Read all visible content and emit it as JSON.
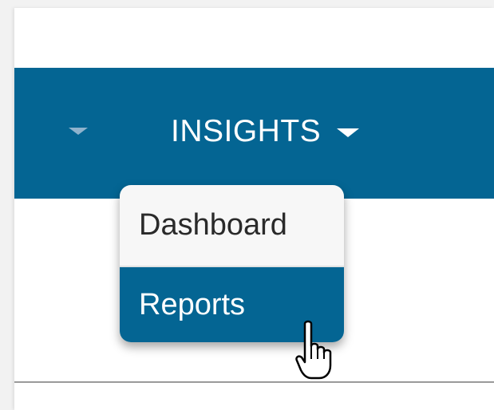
{
  "navbar": {
    "menu_label": "INSIGHTS",
    "colors": {
      "bar": "#046593",
      "text": "#ffffff"
    }
  },
  "dropdown": {
    "items": [
      {
        "label": "Dashboard",
        "state": "default"
      },
      {
        "label": "Reports",
        "state": "hovered"
      }
    ],
    "colors": {
      "default_bg": "#f7f7f7",
      "hover_bg": "#046593"
    }
  },
  "cursor": {
    "icon": "hand-pointer-icon"
  }
}
